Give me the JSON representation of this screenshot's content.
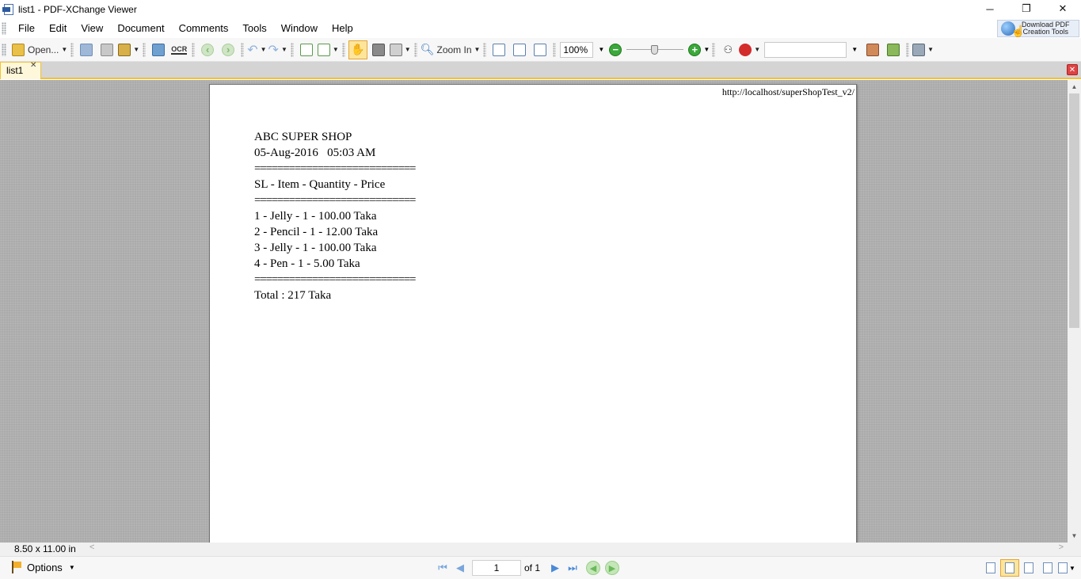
{
  "window": {
    "title": "list1 - PDF-XChange Viewer",
    "minimize": "─",
    "restore": "❐",
    "close": "✕"
  },
  "menu": {
    "items": [
      "File",
      "Edit",
      "View",
      "Document",
      "Comments",
      "Tools",
      "Window",
      "Help"
    ],
    "download_tools_line1": "Download PDF",
    "download_tools_line2": "Creation Tools"
  },
  "toolbar": {
    "open_label": "Open...",
    "ocr_label": "OCR",
    "zoom_in_label": "Zoom In",
    "zoom_value": "100%",
    "zoom_out_symbol": "−",
    "zoom_in_symbol": "+",
    "search_value": ""
  },
  "tabs": {
    "document_tab": "list1",
    "close_symbol": "✕"
  },
  "document": {
    "header_url": "http://localhost/superShopTest_v2/",
    "receipt": {
      "shop_name": "ABC SUPER SHOP",
      "datetime": "05-Aug-2016   05:03 AM",
      "separator": "============================",
      "columns": "SL - Item - Quantity - Price",
      "items": [
        "1 - Jelly - 1 - 100.00 Taka",
        "2 - Pencil - 1 - 12.00 Taka",
        "3 - Jelly - 1 - 100.00 Taka",
        "4 - Pen - 1 - 5.00 Taka"
      ],
      "total": "Total : 217 Taka"
    }
  },
  "status": {
    "page_size": "8.50 x 11.00 in"
  },
  "bottom": {
    "options_label": "Options",
    "current_page": "1",
    "page_of": "of 1"
  }
}
